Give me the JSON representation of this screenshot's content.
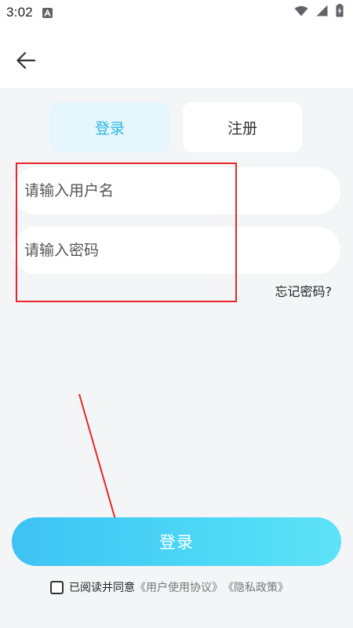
{
  "status_bar": {
    "time": "3:02",
    "icons": [
      "app-a-icon",
      "wifi-icon",
      "signal-icon",
      "battery-charging-icon"
    ]
  },
  "top_bar": {
    "back_icon": "arrow-left-icon"
  },
  "tabs": {
    "login_label": "登录",
    "register_label": "注册",
    "active": "login"
  },
  "form": {
    "username_placeholder": "请输入用户名",
    "username_value": "",
    "password_placeholder": "请输入密码",
    "password_value": "",
    "forgot_label": "忘记密码?"
  },
  "login_button_label": "登录",
  "agreement": {
    "checked": false,
    "text": "已阅读并同意",
    "user_agreement": "《用户使用协议》",
    "privacy_policy": "《隐私政策》"
  },
  "colors": {
    "accent": "#2cb6e4",
    "active_tab_bg": "#e6f6fd",
    "page_bg": "#f4f5f7",
    "button_gradient_start": "#3ec2f3",
    "button_gradient_end": "#5ce3f7",
    "annotation": "#e8262b"
  }
}
